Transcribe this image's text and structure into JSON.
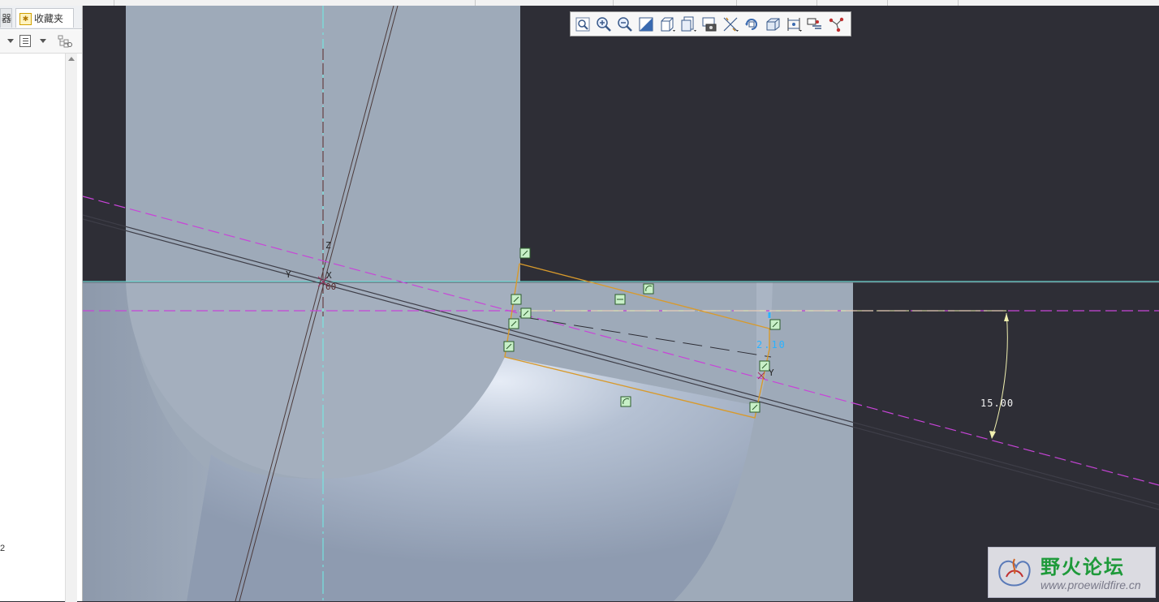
{
  "sidebar": {
    "tab_partial": "器",
    "tab_favorites": "收藏夹",
    "bottom_digit": "2"
  },
  "toolbar": {
    "icons": [
      "refit-icon",
      "zoom-in-icon",
      "zoom-out-icon",
      "repaint-icon",
      "display-style-icon",
      "saved-views-icon",
      "view-manager-icon",
      "datum-display-icon",
      "spin-center-icon",
      "annotation-display-icon",
      "sketch-display-icon",
      "sketch-constraints-icon",
      "sketch-vertices-icon"
    ]
  },
  "viewport": {
    "axis_z": "Z",
    "axis_x": "X",
    "axis_y": "Y",
    "axis_y2": "Y",
    "axis_origin": "00",
    "dim_angle": "15.00",
    "dim_length": "2.10"
  },
  "watermark": {
    "text": "野火论坛",
    "url": "www.proewildfire.cn"
  }
}
